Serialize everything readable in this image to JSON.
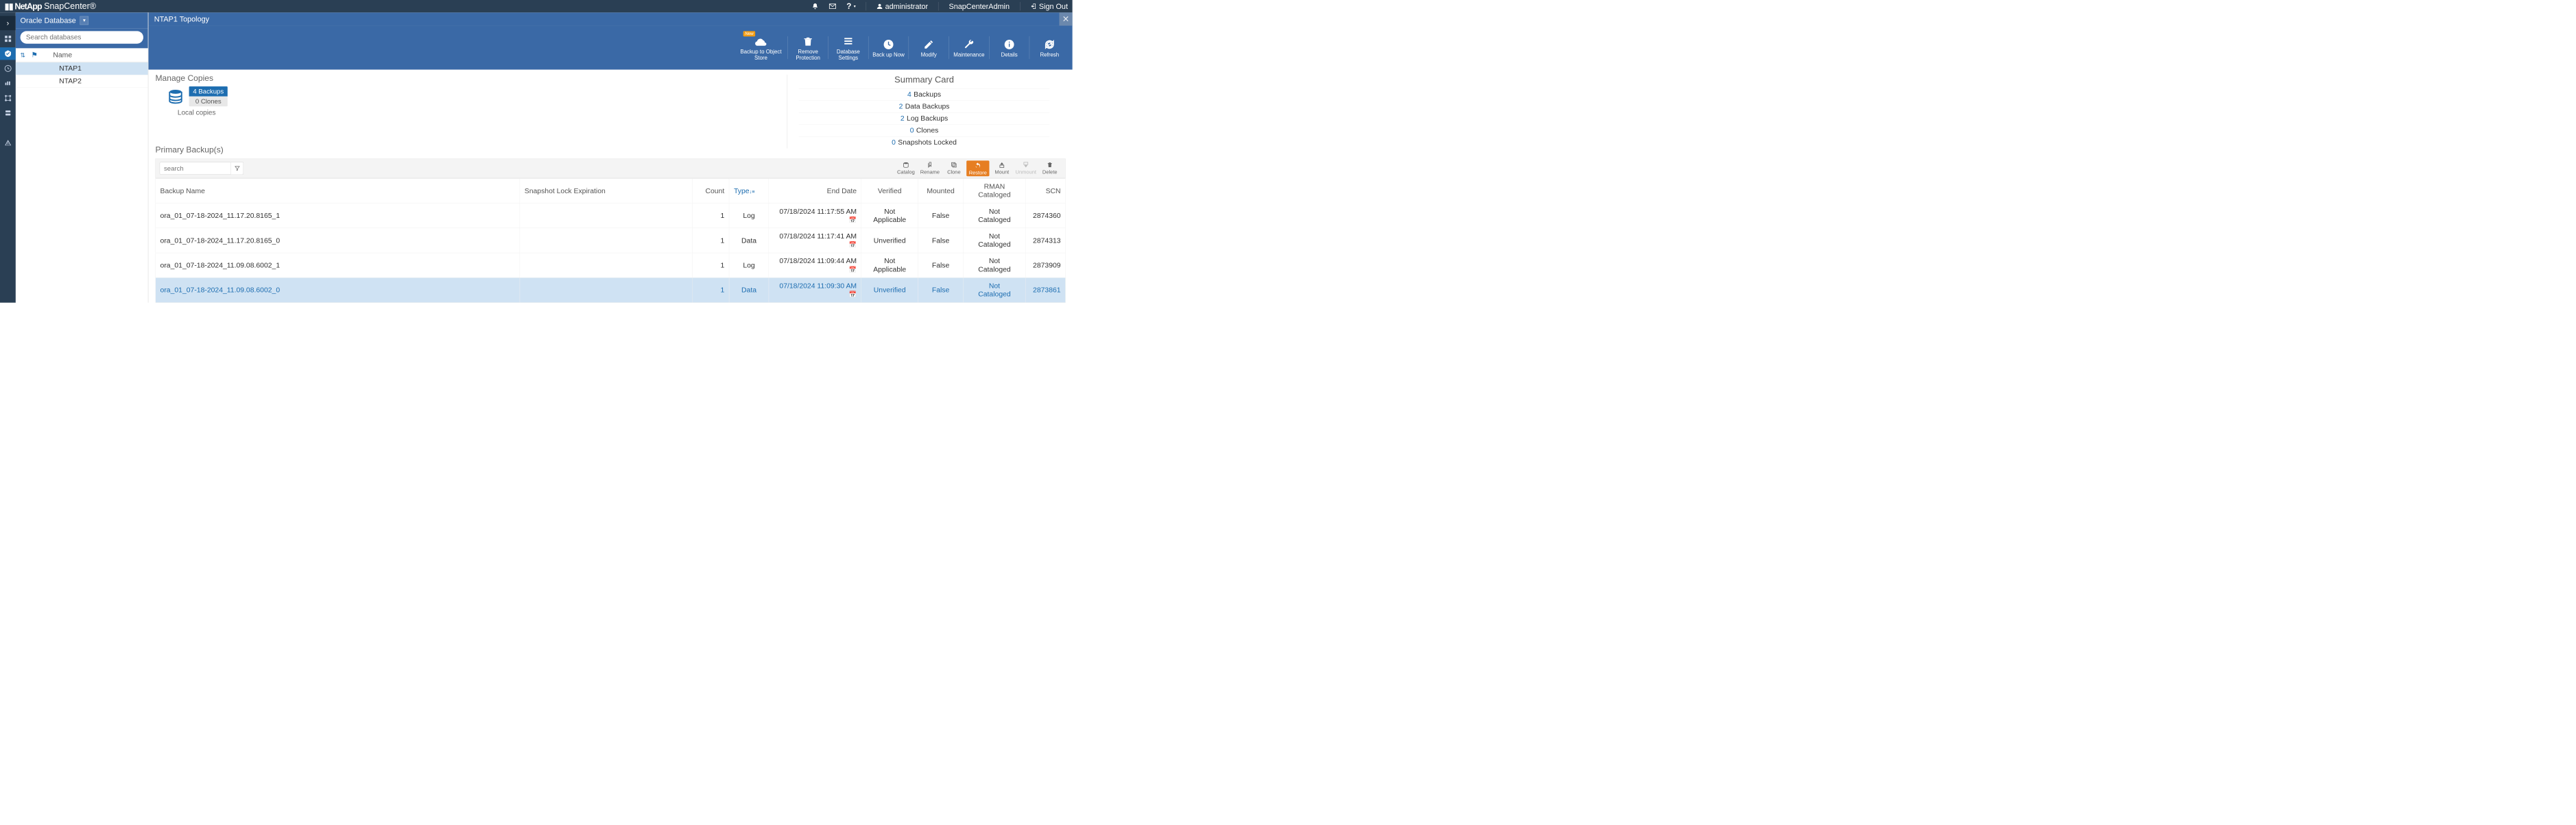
{
  "brand": {
    "vendor": "NetApp",
    "product": "SnapCenter®"
  },
  "topbar": {
    "help": "?",
    "user_label": "administrator",
    "role": "SnapCenterAdmin",
    "signout": "Sign Out"
  },
  "left": {
    "resource_type": "Oracle Database",
    "search_placeholder": "Search databases",
    "col_name": "Name",
    "rows": [
      {
        "name": "NTAP1",
        "selected": true
      },
      {
        "name": "NTAP2",
        "selected": false
      }
    ]
  },
  "content": {
    "title": "NTAP1 Topology",
    "toolbar": [
      {
        "key": "bos",
        "label": "Backup to Object Store",
        "icon": "cloud",
        "badge": "New",
        "wide": true
      },
      {
        "key": "rp",
        "label": "Remove Protection",
        "icon": "trash"
      },
      {
        "key": "ds",
        "label": "Database Settings",
        "icon": "list"
      },
      {
        "key": "bun",
        "label": "Back up Now",
        "icon": "clock"
      },
      {
        "key": "mod",
        "label": "Modify",
        "icon": "pencil"
      },
      {
        "key": "mnt",
        "label": "Maintenance",
        "icon": "wrench"
      },
      {
        "key": "det",
        "label": "Details",
        "icon": "info"
      },
      {
        "key": "ref",
        "label": "Refresh",
        "icon": "refresh"
      }
    ],
    "manage_copies": {
      "title": "Manage Copies",
      "backups_label": "4 Backups",
      "clones_label": "0 Clones",
      "local_label": "Local copies"
    },
    "summary": {
      "title": "Summary Card",
      "rows": [
        {
          "num": "4",
          "label": "Backups"
        },
        {
          "num": "2",
          "label": "Data Backups"
        },
        {
          "num": "2",
          "label": "Log Backups"
        },
        {
          "num": "0",
          "label": "Clones"
        },
        {
          "num": "0",
          "label": "Snapshots Locked"
        }
      ]
    },
    "primary": {
      "title": "Primary Backup(s)",
      "search_placeholder": "search",
      "actions": [
        {
          "key": "catalog",
          "label": "Catalog",
          "icon": "db"
        },
        {
          "key": "rename",
          "label": "Rename",
          "icon": "tag"
        },
        {
          "key": "clone",
          "label": "Clone",
          "icon": "copy"
        },
        {
          "key": "restore",
          "label": "Restore",
          "icon": "undo",
          "highlight": true
        },
        {
          "key": "mount",
          "label": "Mount",
          "icon": "mount"
        },
        {
          "key": "unmount",
          "label": "Unmount",
          "icon": "unmount",
          "disabled": true
        },
        {
          "key": "delete",
          "label": "Delete",
          "icon": "trash"
        }
      ],
      "columns": {
        "backup_name": "Backup Name",
        "sle": "Snapshot Lock Expiration",
        "count": "Count",
        "type": "Type",
        "end_date": "End Date",
        "verified": "Verified",
        "mounted": "Mounted",
        "rman": "RMAN Cataloged",
        "scn": "SCN"
      },
      "rows": [
        {
          "name": "ora_01_07-18-2024_11.17.20.8165_1",
          "sle": "",
          "count": "1",
          "type": "Log",
          "end": "07/18/2024 11:17:55 AM",
          "verified": "Not Applicable",
          "mounted": "False",
          "rman": "Not Cataloged",
          "scn": "2874360",
          "selected": false
        },
        {
          "name": "ora_01_07-18-2024_11.17.20.8165_0",
          "sle": "",
          "count": "1",
          "type": "Data",
          "end": "07/18/2024 11:17:41 AM",
          "verified": "Unverified",
          "mounted": "False",
          "rman": "Not Cataloged",
          "scn": "2874313",
          "selected": false
        },
        {
          "name": "ora_01_07-18-2024_11.09.08.6002_1",
          "sle": "",
          "count": "1",
          "type": "Log",
          "end": "07/18/2024 11:09:44 AM",
          "verified": "Not Applicable",
          "mounted": "False",
          "rman": "Not Cataloged",
          "scn": "2873909",
          "selected": false
        },
        {
          "name": "ora_01_07-18-2024_11.09.08.6002_0",
          "sle": "",
          "count": "1",
          "type": "Data",
          "end": "07/18/2024 11:09:30 AM",
          "verified": "Unverified",
          "mounted": "False",
          "rman": "Not Cataloged",
          "scn": "2873861",
          "selected": true
        }
      ]
    }
  }
}
